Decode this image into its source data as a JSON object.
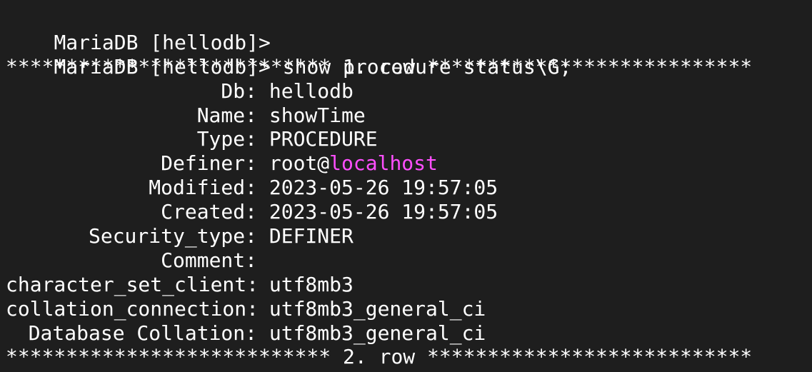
{
  "terminal": {
    "prompt": "MariaDB [hellodb]>",
    "command": " show procedure status\\G;",
    "row1_separator": "*************************** 1. row ***************************",
    "row2_separator": "*************************** 2. row ***************************",
    "highlight_color": "#ff4fff",
    "fields": [
      {
        "label": "Db:",
        "value": "hellodb"
      },
      {
        "label": "Name:",
        "value": "showTime"
      },
      {
        "label": "Type:",
        "value": "PROCEDURE"
      },
      {
        "label": "Definer:",
        "value": "root@",
        "value_highlight": "localhost"
      },
      {
        "label": "Modified:",
        "value": "2023-05-26 19:57:05"
      },
      {
        "label": "Created:",
        "value": "2023-05-26 19:57:05"
      },
      {
        "label": "Security_type:",
        "value": "DEFINER"
      },
      {
        "label": "Comment:",
        "value": ""
      },
      {
        "label": "character_set_client:",
        "value": "utf8mb3"
      },
      {
        "label": "collation_connection:",
        "value": "utf8mb3_general_ci"
      },
      {
        "label": "Database Collation:",
        "value": "utf8mb3_general_ci"
      }
    ]
  }
}
